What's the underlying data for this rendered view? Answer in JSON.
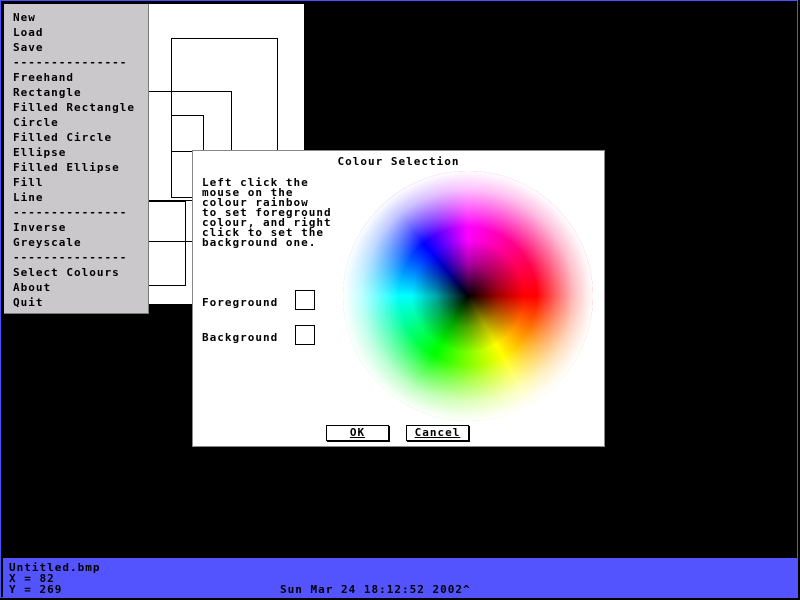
{
  "menu": {
    "items": [
      {
        "label": "New",
        "type": "item"
      },
      {
        "label": "Load",
        "type": "item"
      },
      {
        "label": "Save",
        "type": "item"
      },
      {
        "label": "---------------",
        "type": "separator"
      },
      {
        "label": "Freehand",
        "type": "item"
      },
      {
        "label": "Rectangle",
        "type": "item"
      },
      {
        "label": "Filled Rectangle",
        "type": "item"
      },
      {
        "label": "Circle",
        "type": "item"
      },
      {
        "label": "Filled Circle",
        "type": "item"
      },
      {
        "label": "Ellipse",
        "type": "item"
      },
      {
        "label": "Filled Ellipse",
        "type": "item"
      },
      {
        "label": "Fill",
        "type": "item"
      },
      {
        "label": "Line",
        "type": "item"
      },
      {
        "label": "---------------",
        "type": "separator"
      },
      {
        "label": "Inverse",
        "type": "item"
      },
      {
        "label": "Greyscale",
        "type": "item"
      },
      {
        "label": "---------------",
        "type": "separator"
      },
      {
        "label": "Select Colours",
        "type": "item"
      },
      {
        "label": "About",
        "type": "item"
      },
      {
        "label": "Quit",
        "type": "item"
      }
    ]
  },
  "dialog": {
    "title": "Colour Selection",
    "instructions": "Left click the\nmouse on the\ncolour rainbow\nto set foreground\ncolour, and right\nclick to set the\nbackground one.",
    "foreground_label": "Foreground",
    "background_label": "Background",
    "ok_label": "OK",
    "cancel_label": "Cancel"
  },
  "status": {
    "filename": "Untitled.bmp",
    "x_readout": "X = 82",
    "y_readout": "Y = 269",
    "clock": "Sun Mar 24 18:12:52 2002^"
  },
  "colors": {
    "background": "#000000",
    "menu": "#cbc8cc",
    "statusbar": "#5454ff",
    "canvas": "#ffffff"
  }
}
